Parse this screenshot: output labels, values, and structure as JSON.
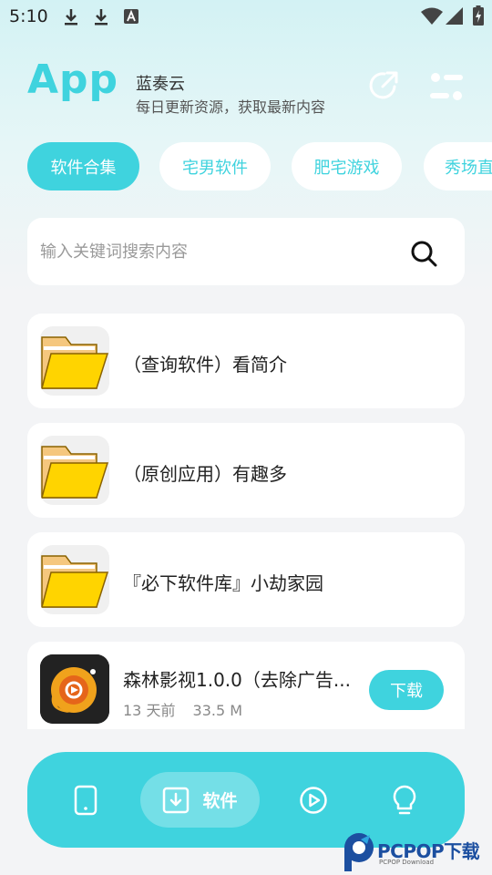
{
  "status_bar": {
    "time": "5:10"
  },
  "header": {
    "logo": "App",
    "app_name": "蓝奏云",
    "slogan": "每日更新资源，获取最新内容"
  },
  "tabs": [
    {
      "label": "软件合集",
      "active": true
    },
    {
      "label": "宅男软件",
      "active": false
    },
    {
      "label": "肥宅游戏",
      "active": false
    },
    {
      "label": "秀场直",
      "active": false
    }
  ],
  "search": {
    "placeholder": "输入关键词搜索内容"
  },
  "folders": [
    {
      "title": "（查询软件）看简介",
      "icon": "folder-icon"
    },
    {
      "title": "（原创应用）有趣多",
      "icon": "folder-icon"
    },
    {
      "title": "『必下软件库』小劫家园",
      "icon": "folder-icon"
    }
  ],
  "app_item": {
    "title": "森林影视1.0.0（去除广告...",
    "time": "13 天前",
    "size": "33.5 M",
    "button": "下载"
  },
  "bottom_nav": [
    {
      "icon": "phone-icon",
      "label": ""
    },
    {
      "icon": "download-box-icon",
      "label": "软件",
      "active": true
    },
    {
      "icon": "play-icon",
      "label": ""
    },
    {
      "icon": "lightbulb-icon",
      "label": ""
    }
  ],
  "watermark": {
    "text": "PCPOP下载",
    "sub": "PCPOP Download"
  },
  "colors": {
    "accent": "#3fd3de",
    "folder": "#ffd400",
    "folder_back": "#f5c77e"
  }
}
